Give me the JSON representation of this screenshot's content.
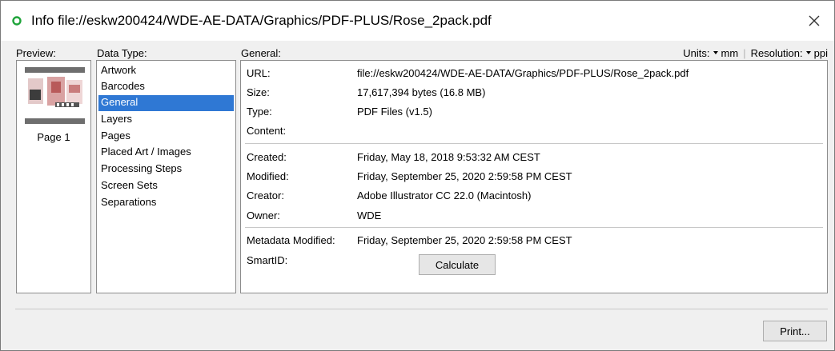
{
  "window": {
    "title": "Info file://eskw200424/WDE-AE-DATA/Graphics/PDF-PLUS/Rose_2pack.pdf",
    "title_icon": "green-circle-icon",
    "close_icon": "close-icon",
    "accent_color": "#2f78d4",
    "status_color": "#1fa43a"
  },
  "preview": {
    "label": "Preview:",
    "pages": [
      {
        "label": "Page 1"
      }
    ]
  },
  "data_type": {
    "label": "Data Type:",
    "items": [
      {
        "label": "Artwork",
        "selected": false
      },
      {
        "label": "Barcodes",
        "selected": false
      },
      {
        "label": "General",
        "selected": true
      },
      {
        "label": "Layers",
        "selected": false
      },
      {
        "label": "Pages",
        "selected": false
      },
      {
        "label": "Placed Art / Images",
        "selected": false
      },
      {
        "label": "Processing Steps",
        "selected": false
      },
      {
        "label": "Screen Sets",
        "selected": false
      },
      {
        "label": "Separations",
        "selected": false
      }
    ]
  },
  "general": {
    "label": "General:",
    "units_label": "Units:",
    "units_value": "mm",
    "resolution_label": "Resolution:",
    "resolution_value": "ppi",
    "rows": [
      {
        "key": "URL:",
        "value": "file://eskw200424/WDE-AE-DATA/Graphics/PDF-PLUS/Rose_2pack.pdf"
      },
      {
        "key": "Size:",
        "value": "17,617,394 bytes (16.8 MB)"
      },
      {
        "key": "Type:",
        "value": "PDF Files (v1.5)"
      },
      {
        "key": "Content:",
        "value": ""
      },
      {
        "key": "Created:",
        "value": "Friday, May 18, 2018 9:53:32 AM CEST"
      },
      {
        "key": "Modified:",
        "value": "Friday, September 25, 2020 2:59:58 PM CEST"
      },
      {
        "key": "Creator:",
        "value": "Adobe Illustrator CC 22.0 (Macintosh)"
      },
      {
        "key": "Owner:",
        "value": "WDE"
      },
      {
        "key": "Metadata Modified:",
        "value": "Friday, September 25, 2020 2:59:58 PM CEST"
      },
      {
        "key": "SmartID:",
        "value": ""
      }
    ],
    "calculate_label": "Calculate"
  },
  "footer": {
    "print_label": "Print..."
  }
}
